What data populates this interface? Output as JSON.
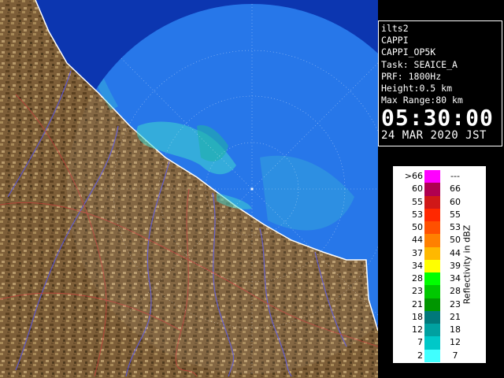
{
  "radar": {
    "colors": {
      "background": "#000000",
      "coverage_ocean": "#1a6fe8",
      "outside_ocean": "#0c36b0",
      "land": "#7d5e38",
      "land_highlight": "#a88a58",
      "coast_outline": "#ffffff",
      "rivers": "#5c58d8",
      "roads": "#c0403a",
      "echo_light": "#40d8d0",
      "echo_mid": "#20b0a8"
    }
  },
  "info": {
    "site": "ilts2",
    "product": "CAPPI",
    "product_name": "CAPPI_OP5K",
    "task": "Task: SEAICE_A",
    "prf": "PRF: 1800Hz",
    "height": "Height:0.5 km",
    "max_range": "Max Range:80 km",
    "time": "05:30:00",
    "date": "24 MAR 2020 JST"
  },
  "legend": {
    "unit_label": "Reflectivity in dBZ",
    "rows": [
      {
        "lo": ">66",
        "hi": "---",
        "color": "#ff00ff"
      },
      {
        "lo": "60",
        "hi": "66",
        "color": "#b00050"
      },
      {
        "lo": "55",
        "hi": "60",
        "color": "#d01818"
      },
      {
        "lo": "53",
        "hi": "55",
        "color": "#ff2800"
      },
      {
        "lo": "50",
        "hi": "53",
        "color": "#ff5000"
      },
      {
        "lo": "44",
        "hi": "50",
        "color": "#ff8000"
      },
      {
        "lo": "37",
        "hi": "44",
        "color": "#ffb800"
      },
      {
        "lo": "34",
        "hi": "39",
        "color": "#ffff00"
      },
      {
        "lo": "28",
        "hi": "34",
        "color": "#00ff00"
      },
      {
        "lo": "23",
        "hi": "28",
        "color": "#00c800"
      },
      {
        "lo": "21",
        "hi": "23",
        "color": "#009600"
      },
      {
        "lo": "18",
        "hi": "21",
        "color": "#00787a"
      },
      {
        "lo": "12",
        "hi": "18",
        "color": "#00a0a0"
      },
      {
        "lo": "7",
        "hi": "12",
        "color": "#00c8c8"
      },
      {
        "lo": "2",
        "hi": "7",
        "color": "#40ffff"
      }
    ]
  }
}
